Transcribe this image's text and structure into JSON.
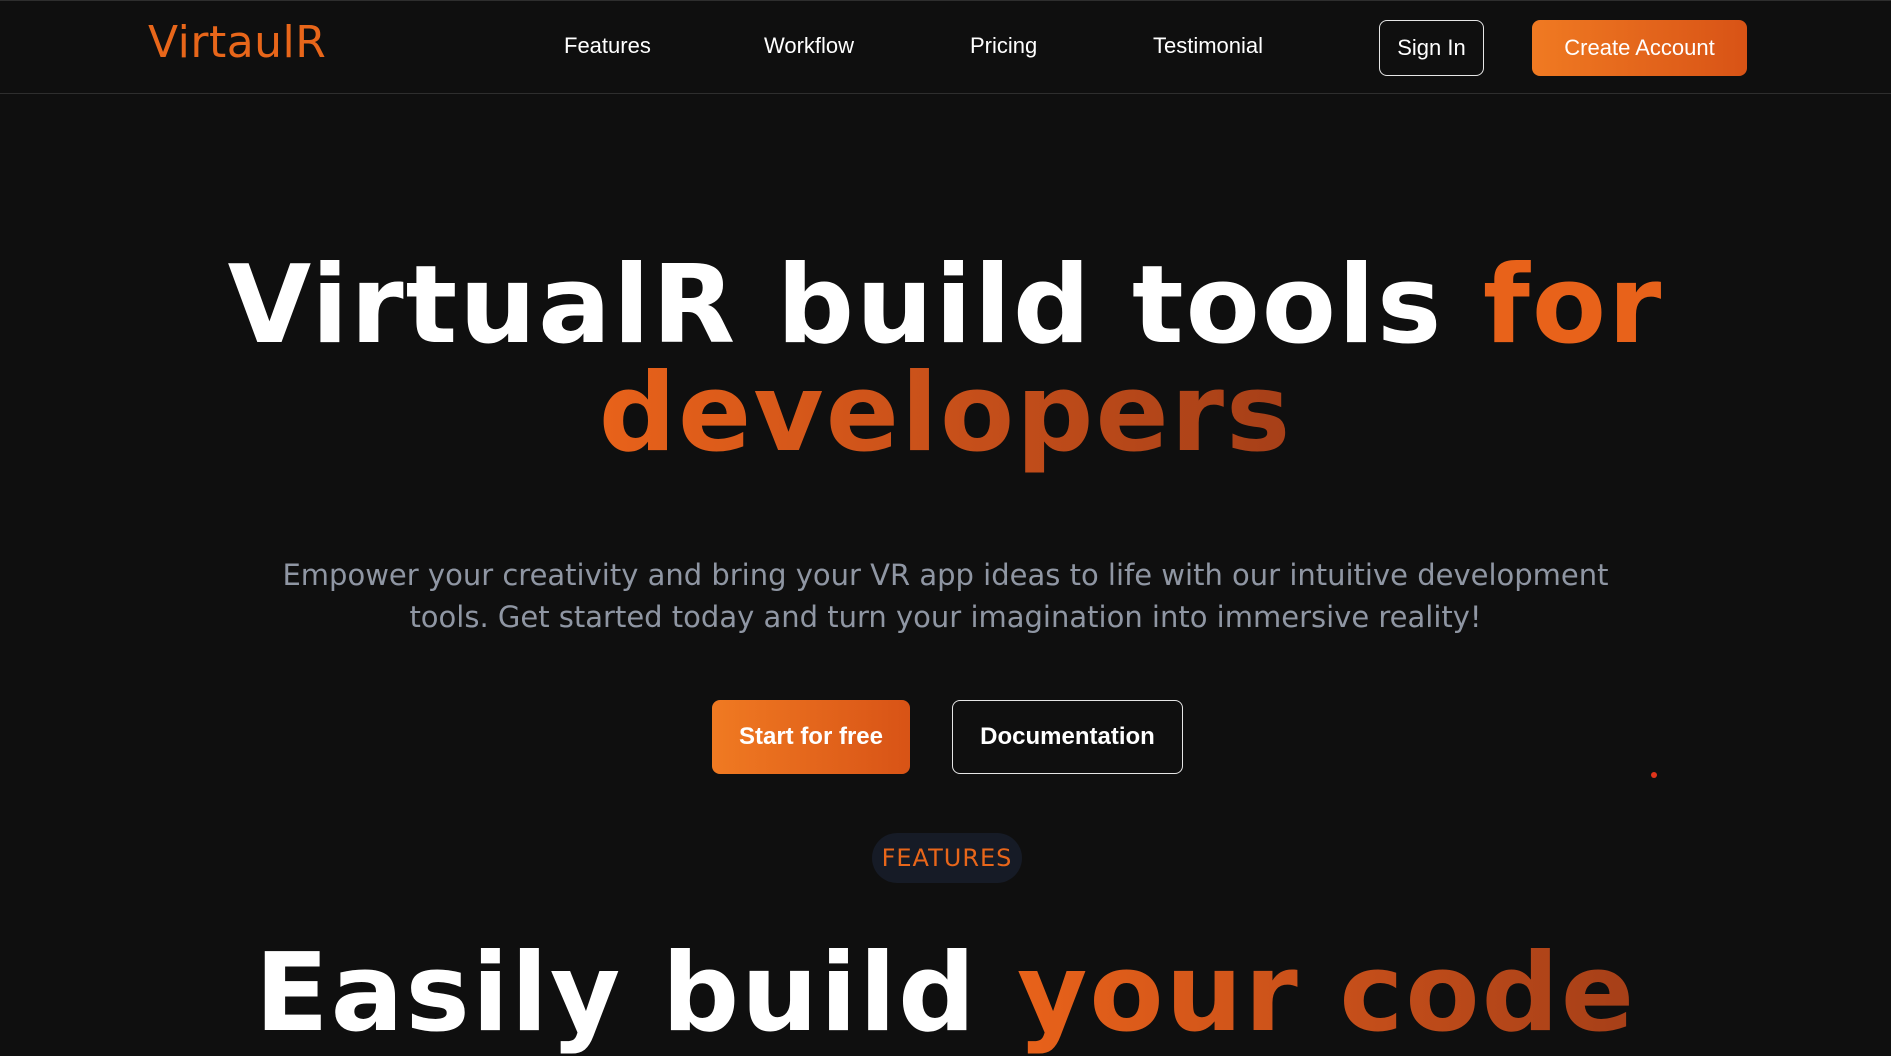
{
  "header": {
    "brand": "VirtaulR",
    "nav": {
      "features": "Features",
      "workflow": "Workflow",
      "pricing": "Pricing",
      "testimonial": "Testimonial"
    },
    "sign_in": "Sign In",
    "create_account": "Create Account"
  },
  "hero": {
    "title_white": "VirtualR build tools ",
    "title_accent_1": "for",
    "title_accent_2": "developers",
    "subtitle_line_1": "Empower your creativity and bring your VR app ideas to life with our intuitive development",
    "subtitle_line_2": "tools. Get started today and turn your imagination into immersive reality!",
    "cta_primary": "Start for free",
    "cta_secondary": "Documentation"
  },
  "features_section": {
    "badge": "FEATURES",
    "title_white": "Easily build ",
    "title_accent": "your code"
  },
  "colors": {
    "background": "#0f0f0f",
    "accent": "#e8661a",
    "accent_dark": "#a63f18",
    "muted_text": "#8f96a3",
    "badge_bg": "#161b26"
  }
}
